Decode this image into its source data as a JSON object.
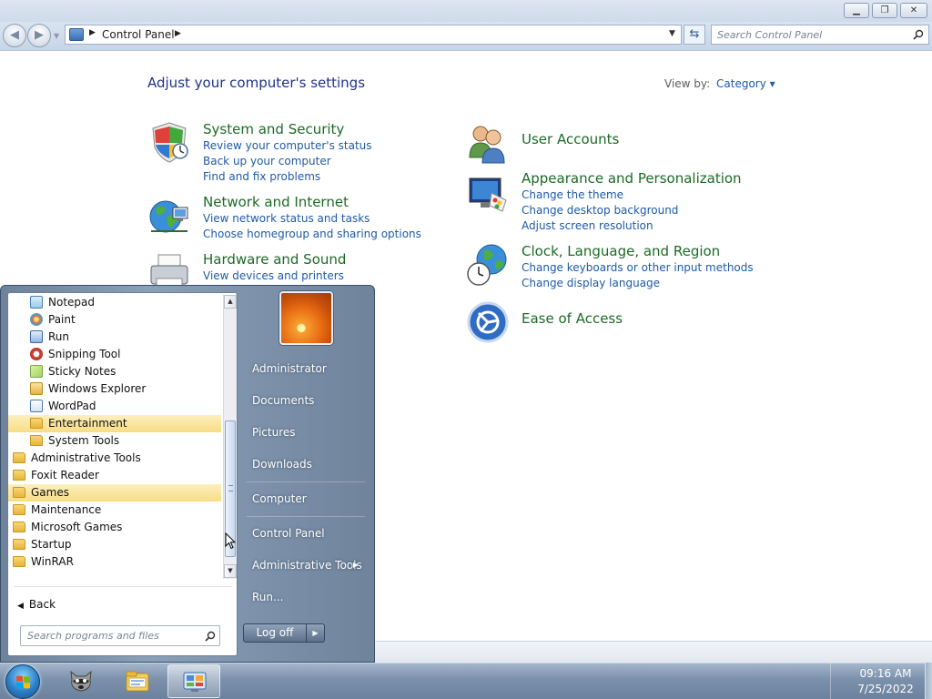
{
  "window": {
    "controls": {
      "minimize": "▁",
      "maximize": "❐",
      "close": "✕"
    },
    "address": {
      "location": "Control Panel",
      "search_placeholder": "Search Control Panel"
    },
    "heading": "Adjust your computer's settings",
    "view_by_label": "View by:",
    "view_by_value": "Category ▾"
  },
  "categories": {
    "system_security": {
      "title": "System and Security",
      "links": [
        "Review your computer's status",
        "Back up your computer",
        "Find and fix problems"
      ]
    },
    "network": {
      "title": "Network and Internet",
      "links": [
        "View network status and tasks",
        "Choose homegroup and sharing options"
      ]
    },
    "hardware": {
      "title": "Hardware and Sound",
      "links": [
        "View devices and printers"
      ]
    },
    "user_accounts": {
      "title": "User Accounts"
    },
    "appearance": {
      "title": "Appearance and Personalization",
      "links": [
        "Change the theme",
        "Change desktop background",
        "Adjust screen resolution"
      ]
    },
    "clock": {
      "title": "Clock, Language, and Region",
      "links": [
        "Change keyboards or other input methods",
        "Change display language"
      ]
    },
    "ease": {
      "title": "Ease of Access"
    }
  },
  "start_menu": {
    "programs": [
      {
        "label": "Notepad",
        "icon": "notepad-icon"
      },
      {
        "label": "Paint",
        "icon": "paint-icon"
      },
      {
        "label": "Run",
        "icon": "run-icon"
      },
      {
        "label": "Snipping Tool",
        "icon": "snipping-tool-icon"
      },
      {
        "label": "Sticky Notes",
        "icon": "sticky-notes-icon"
      },
      {
        "label": "Windows Explorer",
        "icon": "windows-explorer-icon"
      },
      {
        "label": "WordPad",
        "icon": "wordpad-icon"
      },
      {
        "label": "Entertainment",
        "icon": "folder-icon"
      },
      {
        "label": "System Tools",
        "icon": "folder-icon"
      },
      {
        "label": "Administrative Tools",
        "icon": "folder-icon"
      },
      {
        "label": "Foxit Reader",
        "icon": "folder-icon"
      },
      {
        "label": "Games",
        "icon": "folder-icon"
      },
      {
        "label": "Maintenance",
        "icon": "folder-icon"
      },
      {
        "label": "Microsoft Games",
        "icon": "folder-icon"
      },
      {
        "label": "Startup",
        "icon": "folder-icon"
      },
      {
        "label": "WinRAR",
        "icon": "folder-icon"
      }
    ],
    "highlighted": [
      "Entertainment",
      "Games"
    ],
    "back_label": "Back",
    "search_placeholder": "Search programs and files",
    "right_items": [
      "Administrator",
      "Documents",
      "Pictures",
      "Downloads",
      "Computer",
      "Control Panel",
      "Administrative Tools",
      "Run..."
    ],
    "logoff_label": "Log off"
  },
  "taskbar": {
    "time": "09:16 AM",
    "date": "7/25/2022",
    "pinned": [
      "raccoon-app-icon",
      "windows-explorer-icon",
      "control-panel-icon"
    ],
    "active": "control-panel-icon"
  },
  "colors": {
    "heading": "#1e3287",
    "category_title": "#1b6b24",
    "link": "#1e5aa8",
    "highlight": "#f8dd85",
    "taskbar": "#7a90ab"
  }
}
